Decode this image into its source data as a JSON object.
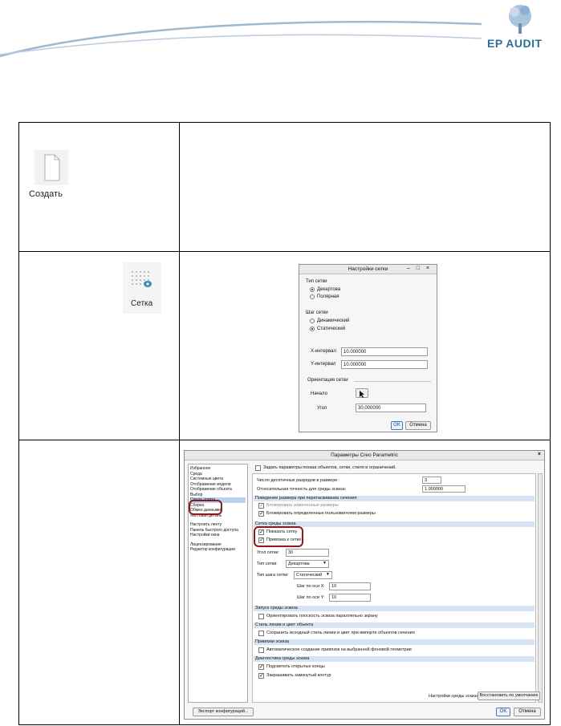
{
  "logo": {
    "text": "EP AUDIT"
  },
  "row1": {
    "create_label": "Создать"
  },
  "row2": {
    "grid_label": "Сетка",
    "dialog": {
      "title": "Настройки сетки",
      "grid_type_label": "Тип сетки",
      "grid_type_options": [
        "Декартова",
        "Полярная"
      ],
      "grid_type_selected": "Декартова",
      "grid_step_label": "Шаг сетки",
      "grid_step_options": [
        "Динамический",
        "Статический"
      ],
      "grid_step_selected": "Статический",
      "x_interval_label": "X-интервал",
      "x_interval_value": "10.000000",
      "y_interval_label": "Y-интервал",
      "y_interval_value": "10.000000",
      "orientation_label": "Ориентация сетки",
      "origin_label": "Начало",
      "angle_label": "Угол",
      "angle_value": "30.000000",
      "ok": "OK",
      "cancel": "Отмена"
    }
  },
  "row3": {
    "dialog": {
      "title": "Параметры Creo Parametric",
      "sidebar": [
        "Избранное",
        "Среда",
        "Системные цвета",
        "Отображение модели",
        "Отображение объекта",
        "Выбор",
        "Среда эскиза",
        "Сборка",
        "Обмен данными",
        "Листовая деталь",
        "Настроить ленту",
        "Панель быстрого доступа",
        "Настройки окна",
        "Лицензирование",
        "Редактор конфигурации"
      ],
      "sidebar_selected": "Среда эскиза",
      "top_checkbox": "Задать параметры показа объектов, сетки, стиля и ограничений.",
      "decimal_label": "Число десятичных разрядов в размере:",
      "decimal_value": "3",
      "precision_label": "Относительная точность для среды эскиза:",
      "precision_value": "1.000000",
      "section_dims": "Поведение размера при перетаскивании сечения",
      "lock_changed": "Блокировать измененные размеры",
      "lock_user": "Блокировать определенные пользователем размеры",
      "section_grid": "Сетка среды эскиза",
      "show_grid": "Показать сетку",
      "snap_grid": "Привязка к сетке",
      "grid_angle_label": "Угол сетки:",
      "grid_angle_value": "30",
      "grid_type_label": "Тип сетки:",
      "grid_type_value": "Декартова",
      "grid_step_type_label": "Тип шага сетки:",
      "grid_step_type_value": "Статический",
      "step_x_label": "Шаг по оси X:",
      "step_x_value": "10",
      "step_y_label": "Шаг по оси Y:",
      "step_y_value": "10",
      "section_start": "Запуск среды эскиза",
      "orient_parallel": "Ориентировать плоскость эскиза параллельно экрану",
      "section_style": "Стиль линии и цвет объекта",
      "keep_style": "Сохранить исходный стиль линии и цвет при импорте объектов сечения",
      "section_snap": "Привязки эскиза",
      "auto_snap": "Автоматическое создание привязок на выбранной фоновой геометрии",
      "section_diag": "Диагностика среды эскиза",
      "highlight_open": "Подсветить открытые концы",
      "shade_closed": "Закрашивать замкнутый контур",
      "sketch_settings_label": "Настройки среды эскиза:",
      "restore_defaults": "Восстановить по умолчанию",
      "export_config": "Экспорт конфигураций...",
      "ok": "OK",
      "cancel": "Отмена"
    }
  }
}
